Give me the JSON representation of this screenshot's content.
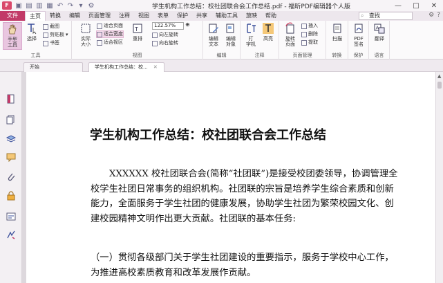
{
  "window": {
    "title": "学生机构工作总结：校社团联合会工作总结.pdf - 福昕PDF编辑器个人版",
    "logo_text": "F",
    "controls": [
      "—",
      "□",
      "✕"
    ]
  },
  "quick_access": [
    "open-icon",
    "save-icon",
    "print-icon",
    "pages-icon",
    "undo-icon",
    "redo-icon",
    "cursor-icon",
    "settings-icon"
  ],
  "menu": {
    "tabs": [
      "文件",
      "主页",
      "转换",
      "编辑",
      "页面管理",
      "注释",
      "视图",
      "表单",
      "保护",
      "共享",
      "辅助工具",
      "放映",
      "帮助"
    ],
    "active": "主页",
    "search_placeholder": "查找",
    "search_icon": "⌕"
  },
  "ribbon": {
    "groups": {
      "tools": {
        "label": "工具",
        "hand": "手型\n工具",
        "select": "选择",
        "snapshot": "截图",
        "clipboard": "剪贴板",
        "bookmark": "书签"
      },
      "view": {
        "label": "视图",
        "actual_size": "实际\n大小",
        "fit_page": "适合页面",
        "fit_width": "适合宽度",
        "fit_visible": "适合视区",
        "reflow": "重排",
        "zoom": "122.57%",
        "rotate_left": "向左旋转",
        "rotate_right": "向右旋转"
      },
      "edit": {
        "label": "编辑",
        "edit_text": "编辑\n文本",
        "edit_object": "编辑\n对象"
      },
      "comment": {
        "label": "注释",
        "typewriter": "打\n字机",
        "highlight": "高亮"
      },
      "page_mgmt": {
        "label": "页面管理",
        "rotate_page": "旋转\n页面",
        "insert": "插入",
        "delete": "删除",
        "extract": "提取"
      },
      "convert": {
        "label": "转换",
        "scan": "扫描"
      },
      "protect": {
        "label": "保护",
        "pdf_sign": "PDF\n签名"
      },
      "language": {
        "label": "语言",
        "translate": "翻译"
      }
    }
  },
  "doc_tabs": [
    {
      "label": "开始",
      "active": false
    },
    {
      "label": "学生机构工作总结：校...",
      "active": true,
      "close": "✕"
    }
  ],
  "sidebar": [
    "pages-icon",
    "thumbnails-icon",
    "layers-icon",
    "comments-icon",
    "attachments-icon",
    "security-icon",
    "form-icon",
    "signature-icon"
  ],
  "document": {
    "title": "学生机构工作总结：校社团联合会工作总结",
    "paragraph": "XXXXXX 校社团联合会(简称“社团联”)是接受校团委领导，协调管理全校学生社团日常事务的组织机构。社团联的宗旨是培养学生综合素质和创新能力，全面服务于学生社团的健康发展，协助学生社团为繁荣校园文化、创建校园精神文明作出更大贡献。社团联的基本任务:",
    "item1": "（一）贯彻各级部门关于学生社团建设的重要指示，服务于学校中心工作，为推进高校素质教育和改革发展作贡献。"
  },
  "colors": {
    "file_tab": "#c23a68",
    "accent": "#d9486b",
    "highlight_btn": "#e9c6e0"
  }
}
